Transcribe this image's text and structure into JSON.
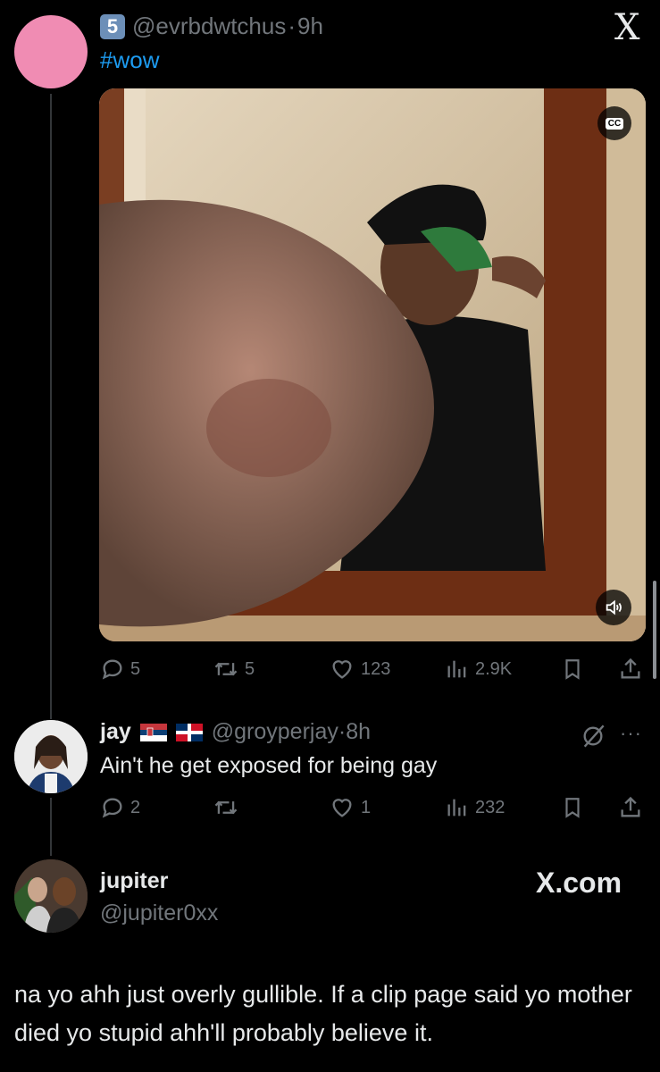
{
  "post1": {
    "badge": "5",
    "handle": "@evrbdwtchus",
    "sep": "·",
    "time": "9h",
    "text": "#wow",
    "x_logo": "X",
    "video": {
      "cc_label": "CC",
      "sound_icon": "speaker-icon"
    },
    "actions": {
      "replies": "5",
      "reposts": "5",
      "likes": "123",
      "views": "2.9K"
    }
  },
  "reply": {
    "name": "jay",
    "flags": [
      "serbia-flag",
      "dominican-flag"
    ],
    "handle": "@groyperjay",
    "sep": "·",
    "time": "8h",
    "text": "Ain't he get exposed for being gay",
    "actions": {
      "replies": "2",
      "reposts": "",
      "likes": "1",
      "views": "232"
    }
  },
  "quote": {
    "name": "jupiter",
    "handle": "@jupiter0xx",
    "brand": "X.com",
    "text": "na yo ahh just overly gullible. If a clip page said yo mother died yo stupid ahh'll probably believe it."
  },
  "colors": {
    "background": "#000000",
    "text": "#e7e9ea",
    "muted": "#71767b",
    "link": "#1d9bf0",
    "badge": "#6c8fb8"
  }
}
